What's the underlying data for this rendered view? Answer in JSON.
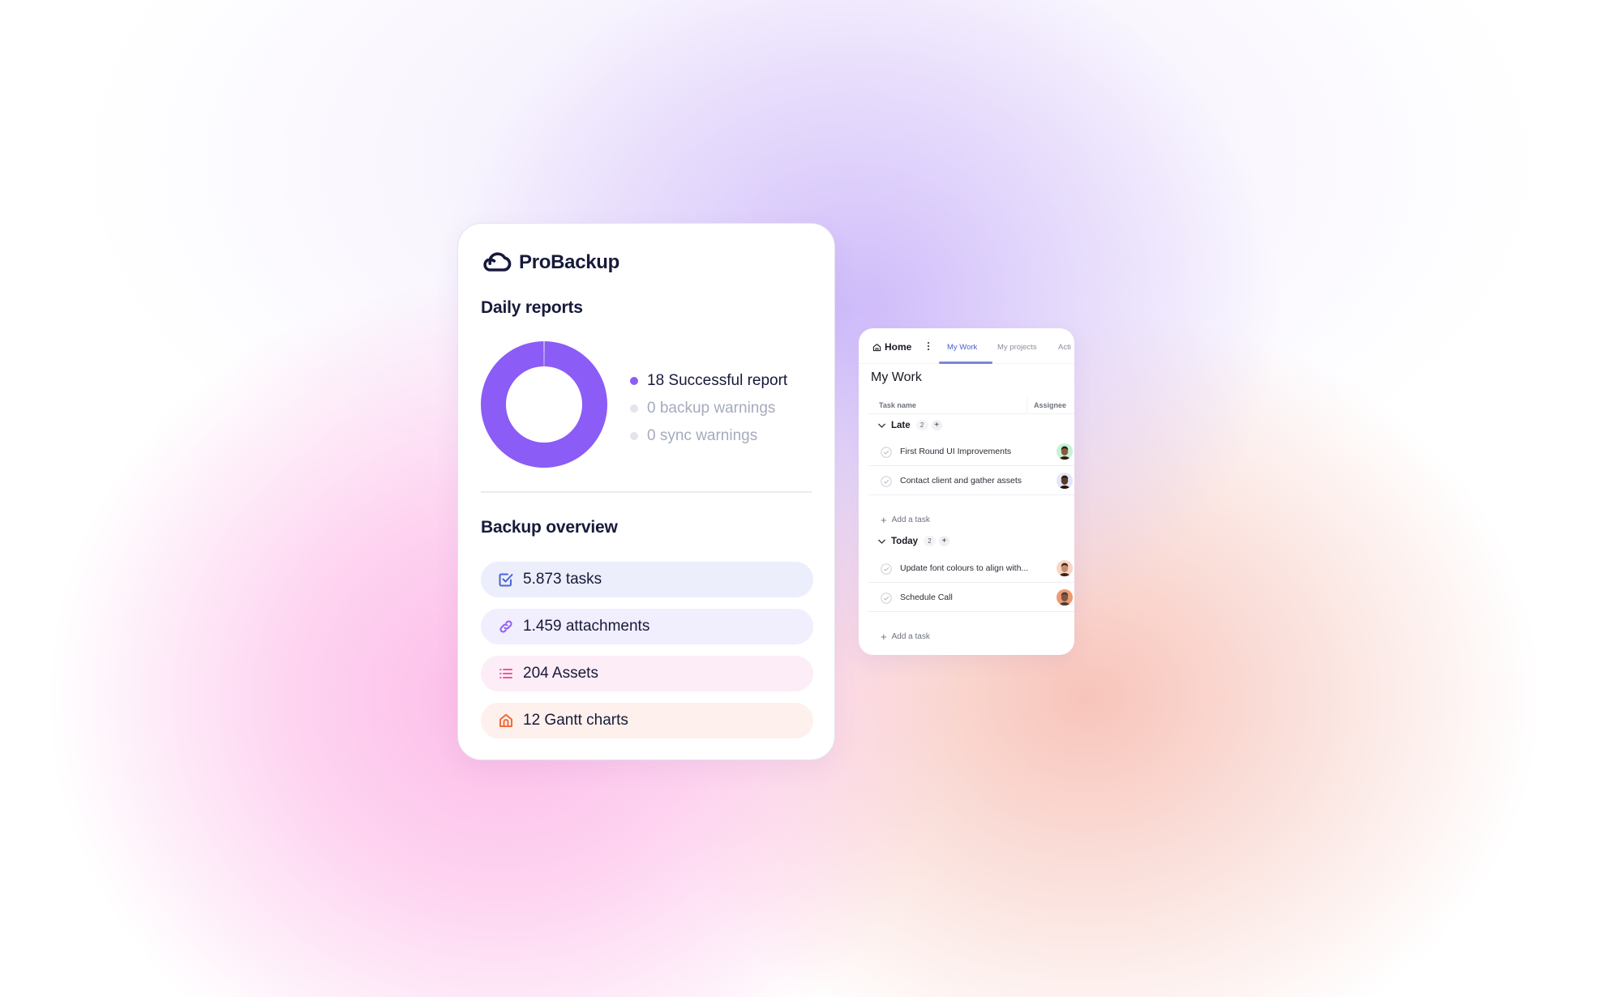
{
  "brand": {
    "name": "ProBackup",
    "icon": "cloud-sync-icon",
    "text_color": "#171A3A"
  },
  "daily_reports": {
    "title": "Daily reports",
    "legend": [
      {
        "label": "18 Successful report",
        "count": 18,
        "color": "#8B5CF6",
        "active": true
      },
      {
        "label": "0 backup warnings",
        "count": 0,
        "color": "#E2E5EC",
        "active": false
      },
      {
        "label": "0 sync warnings",
        "count": 0,
        "color": "#E2E5EC",
        "active": false
      }
    ]
  },
  "chart_data": {
    "type": "pie",
    "variant": "donut",
    "title": "Daily reports",
    "categories": [
      "Successful report",
      "backup warnings",
      "sync warnings"
    ],
    "values": [
      18,
      0,
      0
    ],
    "colors": [
      "#8B5CF6",
      "#E2E5EC",
      "#E2E5EC"
    ],
    "legend": "right"
  },
  "backup_overview": {
    "title": "Backup overview",
    "items": [
      {
        "label": "5.873 tasks",
        "icon": "checkbox-icon",
        "icon_color": "#4B63DB",
        "bg": "#ECEEFB"
      },
      {
        "label": "1.459 attachments",
        "icon": "link-icon",
        "icon_color": "#8B5CF6",
        "bg": "#F1EEFD"
      },
      {
        "label": "204 Assets",
        "icon": "list-icon",
        "icon_color": "#F0569E",
        "bg": "#FDEDF7"
      },
      {
        "label": "12 Gantt charts",
        "icon": "home-icon",
        "icon_color": "#F26B3A",
        "bg": "#FEF0EC"
      }
    ]
  },
  "work": {
    "home_label": "Home",
    "tabs": [
      {
        "label": "My Work",
        "active": true
      },
      {
        "label": "My projects",
        "active": false
      },
      {
        "label": "Acti",
        "active": false
      }
    ],
    "title": "My Work",
    "columns": {
      "task": "Task name",
      "assignee": "Assignee"
    },
    "add_task_label": "Add a task",
    "groups": [
      {
        "name": "Late",
        "count": "2",
        "tasks": [
          {
            "name": "First Round UI Improvements",
            "avatar_bg": "#C6F2D6",
            "skin": "#8A5A3C",
            "hair": "#2A1B12"
          },
          {
            "name": "Contact client and gather assets",
            "avatar_bg": "#E4E6F8",
            "skin": "#5A3A2A",
            "hair": "#1E1410"
          }
        ]
      },
      {
        "name": "Today",
        "count": "2",
        "tasks": [
          {
            "name": "Update font colours to align with...",
            "avatar_bg": "#F7D6C4",
            "skin": "#C48E6E",
            "hair": "#3A2418"
          },
          {
            "name": "Schedule Call",
            "avatar_bg": "#EE9A70",
            "skin": "#7A5646",
            "hair": "#4A3A34"
          }
        ]
      }
    ]
  }
}
